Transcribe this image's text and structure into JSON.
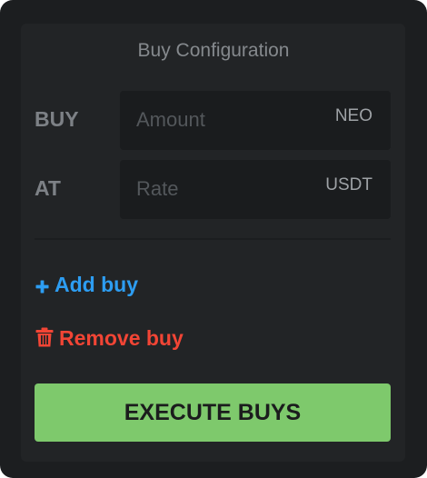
{
  "panel": {
    "title": "Buy Configuration"
  },
  "rows": [
    {
      "label": "BUY",
      "placeholder": "Amount",
      "unit": "NEO"
    },
    {
      "label": "AT",
      "placeholder": "Rate",
      "unit": "USDT"
    }
  ],
  "actions": {
    "add_label": "Add buy",
    "add_icon": "plus-icon",
    "remove_label": "Remove buy",
    "remove_icon": "trash-icon",
    "execute_label": "EXECUTE BUYS"
  },
  "colors": {
    "add": "#2d9df2",
    "remove": "#f24535",
    "execute_bg": "#7ec96c",
    "execute_text": "#1b1c1d"
  }
}
